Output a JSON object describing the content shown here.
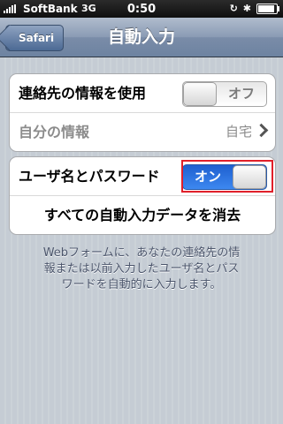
{
  "status": {
    "carrier": "SoftBank",
    "network": "3G",
    "time": "0:50",
    "icons": [
      "rotation-lock-icon",
      "bluetooth-icon",
      "battery-icon"
    ]
  },
  "nav": {
    "back_label": "Safari",
    "title": "自動入力"
  },
  "group1": {
    "use_contact_label": "連絡先の情報を使用",
    "use_contact_switch": "オフ",
    "my_info_label": "自分の情報",
    "my_info_value": "自宅"
  },
  "group2": {
    "names_passwords_label": "ユーザ名とパスワード",
    "names_passwords_switch": "オン",
    "clear_all_label": "すべての自動入力データを消去"
  },
  "footer": {
    "line1": "Webフォームに、あなたの連絡先の情",
    "line2": "報または以前入力したユーザ名とパス",
    "line3": "ワードを自動的に入力します。"
  },
  "colors": {
    "switch_on": "#3d88f0",
    "highlight": "#e0202a",
    "nav": "#6d83a1"
  }
}
